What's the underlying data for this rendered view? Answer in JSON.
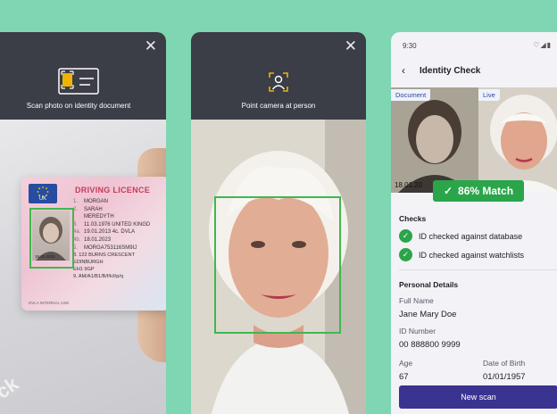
{
  "phone1": {
    "caption": "Scan photo on identity document",
    "close_glyph": "✕",
    "licence": {
      "title": "DRIVING LICENCE",
      "country": "UK",
      "lines": [
        {
          "n": "1.",
          "t": "MORGAN"
        },
        {
          "n": "2.",
          "t": "SARAH"
        },
        {
          "n": "",
          "t": "MEREDYTH"
        },
        {
          "n": "3.",
          "t": "11.03.1976  UNITED KINGD"
        },
        {
          "n": "4a.",
          "t": "19.01.2013  4c. DVLA"
        },
        {
          "n": "4b.",
          "t": "18.01.2023"
        },
        {
          "n": "5.",
          "t": "MORGA753116SM9IJ"
        }
      ],
      "address": [
        "8.  122 BURNS CRESCENT",
        "     EDINBURGH",
        "     EH1 9GP",
        "9.  AM/A1/B1/B/f/k/l/p/q"
      ],
      "photo_date": "18.01.2023",
      "footer": "DVLA INTERNAL USE"
    },
    "watermark": "ck"
  },
  "phone2": {
    "caption": "Point camera at person",
    "close_glyph": "✕"
  },
  "phone3": {
    "time": "9:30",
    "status_icons": "♡◢▮",
    "back_glyph": "‹",
    "title": "Identity Check",
    "tags": {
      "document": "Document",
      "live": "Live"
    },
    "doc_date": "18.01.20",
    "match_text": "86% Match",
    "match_glyph": "✓",
    "checks_heading": "Checks",
    "checks": [
      {
        "label": "ID checked against database"
      },
      {
        "label": "ID checked against watchlists"
      }
    ],
    "check_glyph": "✓",
    "details_heading": "Personal Details",
    "fields": {
      "full_name_label": "Full Name",
      "full_name": "Jane Mary Doe",
      "id_number_label": "ID Number",
      "id_number": "00 888800 9999",
      "age_label": "Age",
      "age": "67",
      "dob_label": "Date of Birth",
      "dob": "01/01/1957"
    },
    "button_label": "New scan"
  },
  "colors": {
    "background": "#7fd6b2",
    "dark_header": "#3b3d47",
    "match_green": "#2aa54a",
    "button": "#3b3390",
    "licence_title": "#c63c59"
  }
}
